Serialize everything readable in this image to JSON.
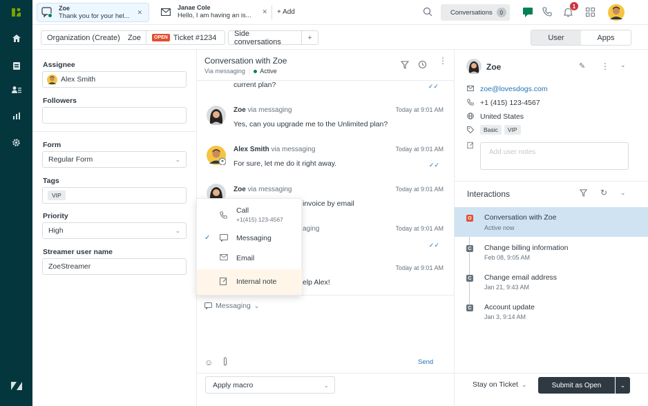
{
  "colors": {
    "nav_bg": "#03363d",
    "brand_green": "#78a300",
    "open_badge": "#e34f32",
    "selected_bg": "#cfe3f3",
    "note_bg": "#fff6e9",
    "submit_bg": "#2f3941",
    "link": "#1f73b7",
    "active_dot": "#038153"
  },
  "tabs": [
    {
      "title": "Zoe",
      "subtitle": "Thank you for your hel...",
      "icon": "chat-icon",
      "active": true
    },
    {
      "title": "Janae Cole",
      "subtitle": "Hello, I am having an is...",
      "icon": "mail-icon",
      "active": false
    }
  ],
  "topbar": {
    "add_label": "+ Add",
    "conversations_label": "Conversations",
    "conversations_count": "0",
    "notification_count": "1"
  },
  "subbar": {
    "org_label": "Organization (Create)",
    "requester": "Zoe",
    "status_badge": "OPEN",
    "ticket": "Ticket #1234",
    "side_conversations": "Side conversations",
    "add": "+",
    "user_tab": "User",
    "apps_tab": "Apps"
  },
  "left": {
    "assignee_label": "Assignee",
    "assignee": "Alex Smith",
    "followers_label": "Followers",
    "form_label": "Form",
    "form_value": "Regular Form",
    "tags_label": "Tags",
    "tag": "VIP",
    "priority_label": "Priority",
    "priority_value": "High",
    "streamer_label": "Streamer user name",
    "streamer_value": "ZoeStreamer"
  },
  "conversation": {
    "title": "Conversation with Zoe",
    "channel": "Via messaging",
    "status": "Active",
    "partial_text": "current plan?",
    "messages": [
      {
        "name": "Zoe",
        "via": "via messaging",
        "time": "Today at 9:01 AM",
        "text": "Yes, can you upgrade me to the Unlimited plan?"
      },
      {
        "name": "Alex Smith",
        "via": "via messaging",
        "time": "Today at 9:01 AM",
        "text": "For sure, let me do it right away."
      },
      {
        "name": "Zoe",
        "via": "via messaging",
        "time": "Today at 9:01 AM",
        "text": "invoice by email"
      },
      {
        "name": "",
        "via": "aging",
        "time": "Today at 9:01 AM",
        "text": ""
      },
      {
        "name": "",
        "via": "",
        "time": "Today at 9:01 AM",
        "text": "elp Alex!"
      }
    ],
    "composer_channel": "Messaging",
    "send_label": "Send"
  },
  "dropdown": {
    "items": [
      {
        "label": "Call",
        "sub": "+1(415) 123-4567",
        "icon": "phone-icon",
        "checked": false
      },
      {
        "label": "Messaging",
        "sub": "",
        "icon": "chat-icon",
        "checked": true
      },
      {
        "label": "Email",
        "sub": "",
        "icon": "mail-icon",
        "checked": false
      },
      {
        "label": "Internal note",
        "sub": "",
        "icon": "note-icon",
        "checked": false
      }
    ]
  },
  "user": {
    "name": "Zoe",
    "email": "zoe@lovesdogs.com",
    "phone": "+1 (415) 123-4567",
    "country": "United States",
    "tags": [
      "Basic",
      "VIP"
    ],
    "notes_placeholder": "Add user notes"
  },
  "interactions": {
    "title": "Interactions",
    "items": [
      {
        "badge": "O",
        "title": "Conversation with Zoe",
        "sub": "Active now",
        "selected": true
      },
      {
        "badge": "C",
        "title": "Change billing information",
        "sub": "Feb 08, 9:05 AM",
        "selected": false
      },
      {
        "badge": "C",
        "title": "Change email address",
        "sub": "Jan 21, 9:43 AM",
        "selected": false
      },
      {
        "badge": "C",
        "title": "Account update",
        "sub": "Jan 3, 9:14 AM",
        "selected": false
      }
    ]
  },
  "footer": {
    "macro_label": "Apply macro",
    "stay_label": "Stay on Ticket",
    "submit_label": "Submit as Open"
  }
}
